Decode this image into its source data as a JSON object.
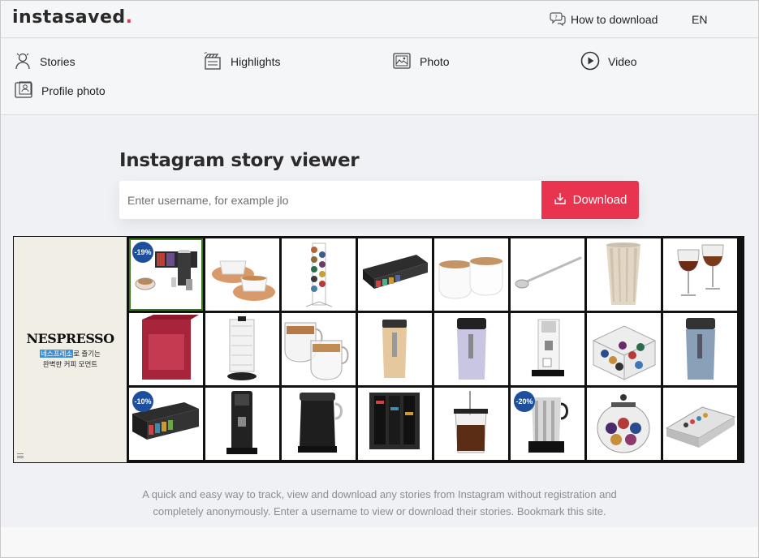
{
  "header": {
    "logo_text": "instasaved",
    "logo_dot": ".",
    "how_to": "How to download",
    "lang": "EN"
  },
  "nav": {
    "items": [
      {
        "label": "Stories",
        "icon": "stories-icon"
      },
      {
        "label": "Highlights",
        "icon": "highlights-icon"
      },
      {
        "label": "Photo",
        "icon": "photo-icon"
      },
      {
        "label": "Video",
        "icon": "video-icon"
      },
      {
        "label": "Profile photo",
        "icon": "profile-photo-icon"
      }
    ]
  },
  "main": {
    "title": "Instagram story viewer",
    "search_placeholder": "Enter username, for example jlo",
    "download_label": "Download",
    "accent_color": "#e8344e"
  },
  "ad": {
    "brand": "NESPRESSO",
    "tagline_highlight": "네스프레소",
    "tagline_rest": "로 즐기는",
    "tagline_line2": "완벽한 커피 모먼트",
    "products": [
      {
        "name": "coffee-machine-bundle",
        "badge": "-19%"
      },
      {
        "name": "cups-with-saucers",
        "badge": ""
      },
      {
        "name": "capsule-tower",
        "badge": ""
      },
      {
        "name": "capsule-sleeves",
        "badge": ""
      },
      {
        "name": "white-cups",
        "badge": ""
      },
      {
        "name": "spoon",
        "badge": ""
      },
      {
        "name": "ribbed-cup",
        "badge": ""
      },
      {
        "name": "wine-glasses",
        "badge": ""
      },
      {
        "name": "gift-box",
        "badge": ""
      },
      {
        "name": "milk-frother-white",
        "badge": ""
      },
      {
        "name": "glass-mugs",
        "badge": ""
      },
      {
        "name": "travel-mug-beige",
        "badge": ""
      },
      {
        "name": "travel-mug-lilac",
        "badge": ""
      },
      {
        "name": "espresso-machine-white",
        "badge": ""
      },
      {
        "name": "capsule-cube",
        "badge": ""
      },
      {
        "name": "travel-mug-blue",
        "badge": ""
      },
      {
        "name": "capsule-sleeves-dark",
        "badge": "-10%"
      },
      {
        "name": "espresso-machine-black",
        "badge": ""
      },
      {
        "name": "milk-frother-black",
        "badge": ""
      },
      {
        "name": "capsule-dispenser",
        "badge": ""
      },
      {
        "name": "iced-glass",
        "badge": ""
      },
      {
        "name": "frother-chrome",
        "badge": "-20%"
      },
      {
        "name": "capsule-jar",
        "badge": ""
      },
      {
        "name": "capsule-drawer",
        "badge": ""
      }
    ]
  },
  "footer": {
    "line1": "A quick and easy way to track, view and download any stories from Instagram without registration and",
    "line2": "completely anonymously. Enter a username to view or download their stories. Bookmark this site."
  }
}
